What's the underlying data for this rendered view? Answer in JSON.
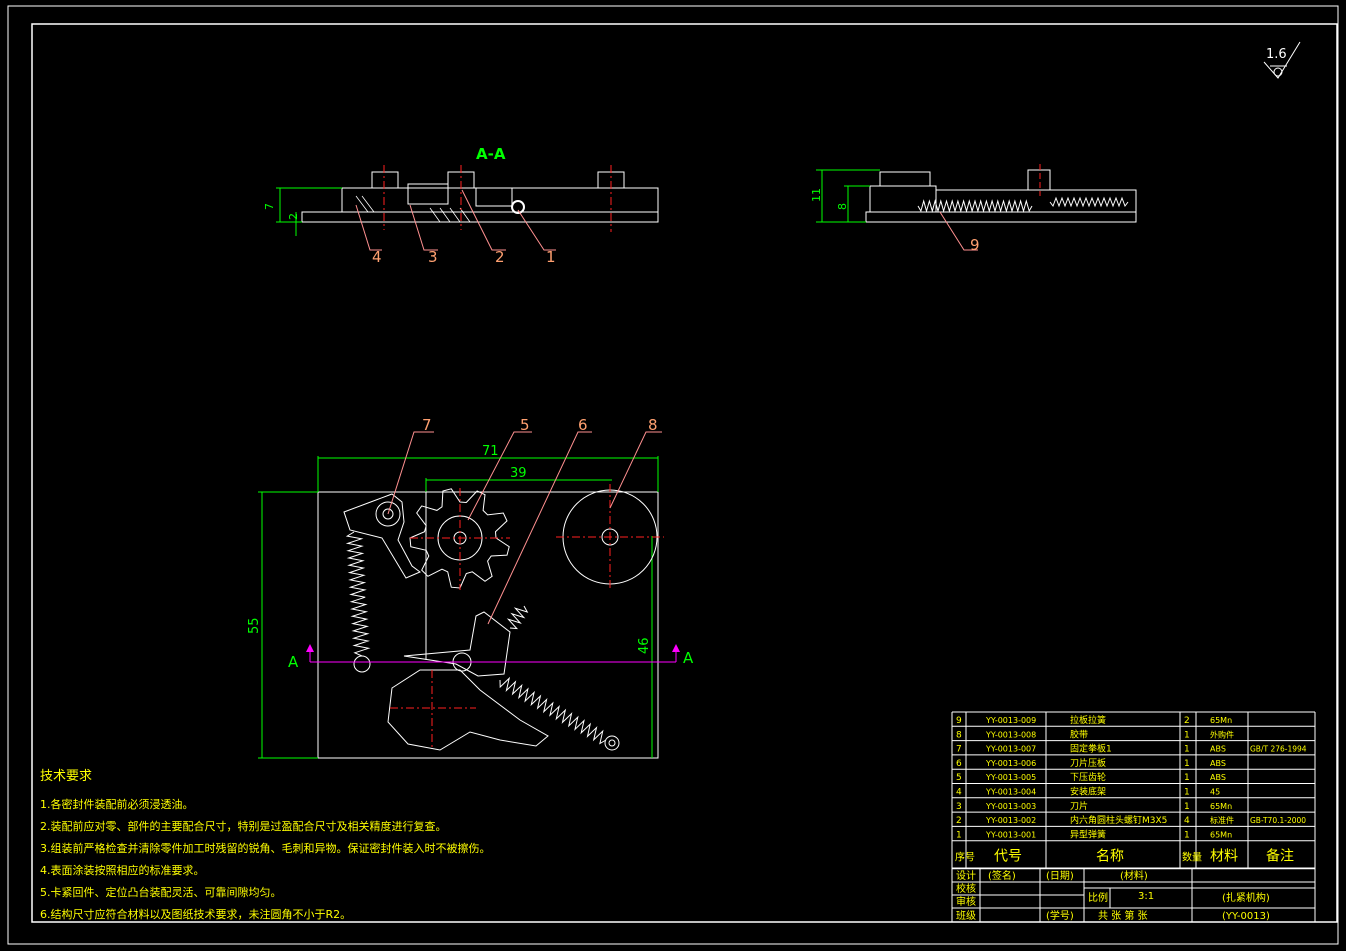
{
  "drawing": {
    "section_label": "A-A",
    "section_marker_left": "A",
    "section_marker_right": "A",
    "roughness_value": "1.6"
  },
  "dimensions": {
    "left_view_7": "7",
    "left_view_2": "2",
    "right_view_11": "11",
    "right_view_8": "8",
    "width_71": "71",
    "width_39": "39",
    "height_55": "55",
    "height_46": "46"
  },
  "balloons": {
    "b1": "1",
    "b2": "2",
    "b3": "3",
    "b4": "4",
    "b5": "5",
    "b6": "6",
    "b7": "7",
    "b8": "8",
    "b9": "9"
  },
  "tech_requirements": {
    "title": "技术要求",
    "items": [
      "1.各密封件装配前必须浸透油。",
      "2.装配前应对零、部件的主要配合尺寸，特别是过盈配合尺寸及相关精度进行复查。",
      "3.组装前严格检查并清除零件加工时残留的锐角、毛刺和异物。保证密封件装入时不被擦伤。",
      "4.表面涂装按照相应的标准要求。",
      "5.卡紧回件、定位凸台装配灵活、可靠间隙均匀。",
      "6.结构尺寸应符合材料以及图纸技术要求，未注圆角不小于R2。"
    ]
  },
  "bom": {
    "rows": [
      {
        "no": "9",
        "code": "YY-0013-009",
        "name": "拉板拉簧",
        "qty": "2",
        "material": "65Mn",
        "note": ""
      },
      {
        "no": "8",
        "code": "YY-0013-008",
        "name": "胶带",
        "qty": "1",
        "material": "外购件",
        "note": ""
      },
      {
        "no": "7",
        "code": "YY-0013-007",
        "name": "固定拳板1",
        "qty": "1",
        "material": "ABS",
        "note": "GB/T 276-1994"
      },
      {
        "no": "6",
        "code": "YY-0013-006",
        "name": "刀片压板",
        "qty": "1",
        "material": "ABS",
        "note": ""
      },
      {
        "no": "5",
        "code": "YY-0013-005",
        "name": "下压齿轮",
        "qty": "1",
        "material": "ABS",
        "note": ""
      },
      {
        "no": "4",
        "code": "YY-0013-004",
        "name": "安装底架",
        "qty": "1",
        "material": "45",
        "note": ""
      },
      {
        "no": "3",
        "code": "YY-0013-003",
        "name": "刀片",
        "qty": "1",
        "material": "65Mn",
        "note": ""
      },
      {
        "no": "2",
        "code": "YY-0013-002",
        "name": "内六角圆柱头螺钉M3X5",
        "qty": "4",
        "material": "标准件",
        "note": "GB-T70.1-2000"
      },
      {
        "no": "1",
        "code": "YY-0013-001",
        "name": "异型弹簧",
        "qty": "1",
        "material": "65Mn",
        "note": ""
      }
    ],
    "header": {
      "no": "序号",
      "code": "代号",
      "name": "名称",
      "qty": "数量",
      "material": "材料",
      "note": "备注"
    }
  },
  "title_block": {
    "design": "设计",
    "check": "校核",
    "review": "审核",
    "class": "班级",
    "sign": "(签名)",
    "date": "(日期)",
    "material": "(材料)",
    "scale_label": "比例",
    "scale": "3:1",
    "drawing_name": "(扎紧机构)",
    "student_no": "(学号)",
    "sheets": "共   张   第   张",
    "drawing_no": "(YY-0013)"
  },
  "colors": {
    "frame": "#ffffff",
    "part": "#ffffff",
    "dimension": "#00ff00",
    "balloon_text": "#ffa070",
    "leader": "#ff9090",
    "centerline": "#ff2020",
    "section_line": "#ff00ff",
    "spring": "#ffffff",
    "text_yellow": "#ffff00"
  }
}
